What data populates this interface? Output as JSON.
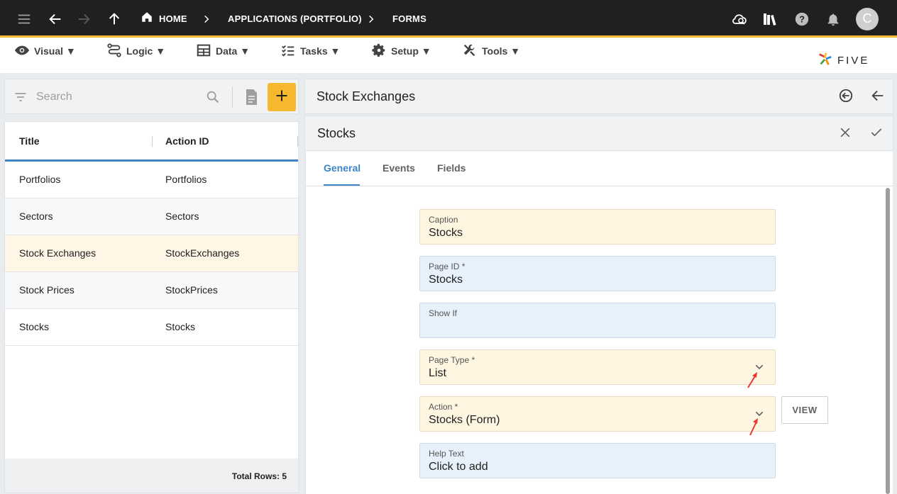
{
  "topbar": {
    "home_label": "HOME",
    "crumb_applications": "APPLICATIONS (PORTFOLIO)",
    "crumb_forms": "FORMS",
    "avatar_initial": "C",
    "accent_color": "#f5b82e"
  },
  "menu": {
    "items": [
      {
        "label": "Visual ▼",
        "icon": "eye-icon"
      },
      {
        "label": "Logic ▼",
        "icon": "logic-icon"
      },
      {
        "label": "Data ▼",
        "icon": "table-icon"
      },
      {
        "label": "Tasks ▼",
        "icon": "checklist-icon"
      },
      {
        "label": "Setup ▼",
        "icon": "gear-icon"
      },
      {
        "label": "Tools ▼",
        "icon": "tools-icon"
      }
    ],
    "logo_text": "FIVE"
  },
  "list": {
    "search_placeholder": "Search",
    "columns": [
      "Title",
      "Action ID"
    ],
    "rows": [
      {
        "title": "Portfolios",
        "action_id": "Portfolios"
      },
      {
        "title": "Sectors",
        "action_id": "Sectors"
      },
      {
        "title": "Stock Exchanges",
        "action_id": "StockExchanges"
      },
      {
        "title": "Stock Prices",
        "action_id": "StockPrices"
      },
      {
        "title": "Stocks",
        "action_id": "Stocks"
      }
    ],
    "total_rows": "Total Rows: 5"
  },
  "panel": {
    "title": "Stock Exchanges",
    "sub_title": "Stocks",
    "tabs": [
      "General",
      "Events",
      "Fields"
    ],
    "active_tab": "General"
  },
  "form": {
    "caption": {
      "label": "Caption",
      "value": "Stocks"
    },
    "page_id": {
      "label": "Page ID *",
      "value": "Stocks"
    },
    "show_if": {
      "label": "Show If",
      "value": ""
    },
    "page_type": {
      "label": "Page Type *",
      "value": "List"
    },
    "action": {
      "label": "Action *",
      "value": "Stocks (Form)"
    },
    "help_text": {
      "label": "Help Text",
      "value": "Click to add"
    },
    "view_label": "VIEW"
  }
}
